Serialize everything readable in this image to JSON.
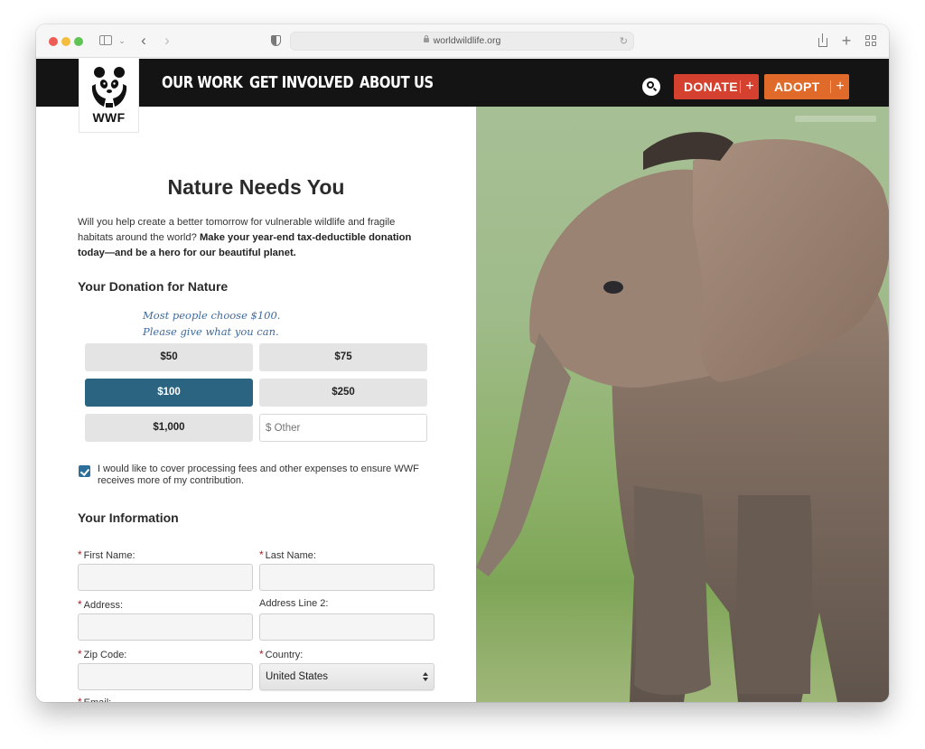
{
  "browser": {
    "url": "worldwildlife.org",
    "icons": [
      "sidebar-icon",
      "chevron-down-icon",
      "back-icon",
      "forward-icon",
      "privacy-shield-icon",
      "lock-icon",
      "reload-icon",
      "share-icon",
      "new-tab-icon",
      "tab-overview-icon"
    ]
  },
  "nav": {
    "logo_text": "WWF",
    "links": [
      {
        "label": "OUR WORK"
      },
      {
        "label": "GET INVOLVED"
      },
      {
        "label": "ABOUT US"
      }
    ],
    "donate": {
      "label": "DONATE",
      "plus": "+"
    },
    "adopt": {
      "label": "ADOPT",
      "plus": "+"
    },
    "colors": {
      "bar": "#141414",
      "donate": "#d4412f",
      "adopt": "#e06a2a"
    }
  },
  "form": {
    "title": "Nature Needs You",
    "intro_plain": "Will you help create a better tomorrow for vulnerable wildlife and fragile habitats around the world? ",
    "intro_bold": "Make your year-end tax-deductible donation today—and be a hero for our beautiful planet.",
    "donation_heading": "Your Donation for Nature",
    "hint_line1": "Most people choose $100.",
    "hint_line2": "Please give what you can.",
    "amounts": [
      {
        "label": "$50",
        "selected": false
      },
      {
        "label": "$75",
        "selected": false
      },
      {
        "label": "$100",
        "selected": true
      },
      {
        "label": "$250",
        "selected": false
      },
      {
        "label": "$1,000",
        "selected": false
      }
    ],
    "other_placeholder": "$ Other",
    "cover_fees": {
      "checked": true,
      "label": "I would like to cover processing fees and other expenses to ensure WWF receives more of my contribution."
    },
    "info_heading": "Your Information",
    "required_marker": "*",
    "fields": {
      "first_name": {
        "label": "First Name:",
        "required": true,
        "value": ""
      },
      "last_name": {
        "label": "Last Name:",
        "required": true,
        "value": ""
      },
      "address": {
        "label": "Address:",
        "required": true,
        "value": ""
      },
      "address2": {
        "label": "Address Line 2:",
        "required": false,
        "value": ""
      },
      "zip": {
        "label": "Zip Code:",
        "required": true,
        "value": ""
      },
      "country": {
        "label": "Country:",
        "required": true,
        "value": "United States"
      },
      "email": {
        "label": "Email:",
        "required": true
      }
    },
    "colors": {
      "selected_amount": "#2a6480",
      "checkbox": "#2d6f9b",
      "required": "#a8232b",
      "hint": "#3e6a9c"
    }
  },
  "hero_image": {
    "subject": "baby elephant walking on grass"
  }
}
